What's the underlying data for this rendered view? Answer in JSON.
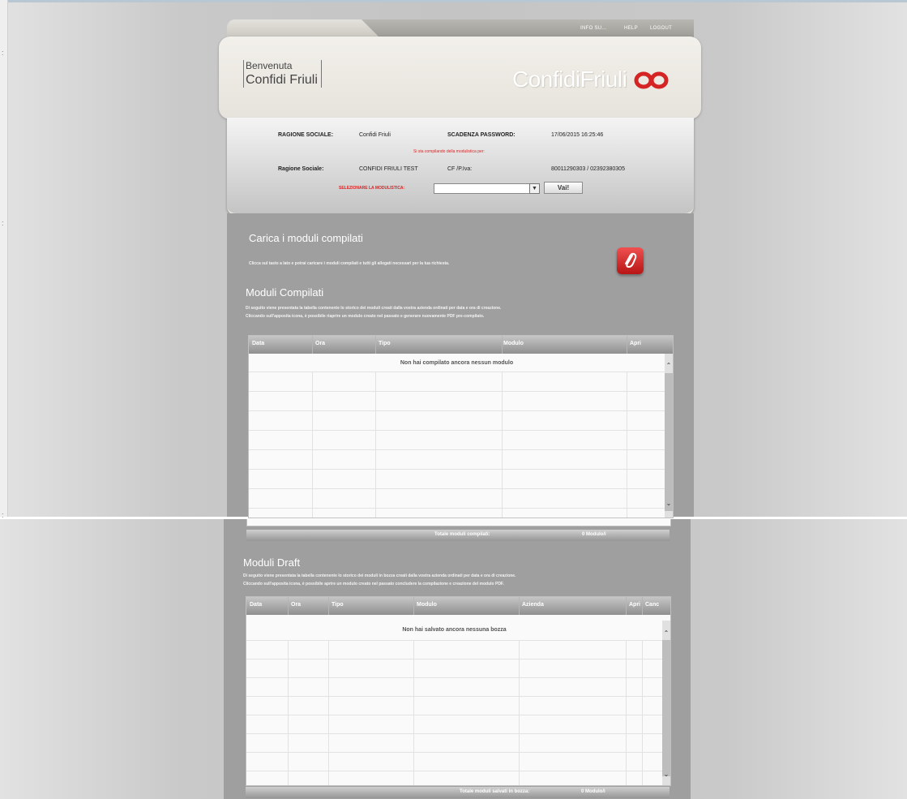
{
  "nav": {
    "info": "INFO SU...",
    "help": "HELP",
    "logout": "LOGOUT"
  },
  "welcome": {
    "line1": "Benvenuta",
    "line2": "Confidi Friuli"
  },
  "logo": {
    "text": "ConfidiFriuli"
  },
  "info": {
    "ragione_label": "RAGIONE SOCIALE:",
    "ragione_value": "Confidi Friuli",
    "scadenza_label": "SCADENZA PASSWORD:",
    "scadenza_value": "17/06/2015 16:25:46",
    "notice": "Si sta compilando della modulistica per:",
    "ragione2_label": "Ragione Sociale:",
    "ragione2_value": "CONFIDI FRIULI TEST",
    "cf_label": "CF /P.Iva:",
    "cf_value": "80011290303 / 02392380305",
    "select_label": "SELEZIONARE LA MODULISTICA:",
    "select_value": "",
    "go_button": "Vai!"
  },
  "upload": {
    "title": "Carica i moduli compilati",
    "text": "Clicca sul tasto a lato e potrai caricare i moduli compilati e tutti gli allegati necessari per la tua richiesta."
  },
  "compilati": {
    "title": "Moduli Compilati",
    "text1": "Di seguito viene presentata la tabella contenente lo storico dei moduli creati dalla vostra azienda ordinati per data e ora di creazione.",
    "text2": "Cliccando sull'apposita icona, è possibile riaprire un modulo creato nel passato e generare nuovamente PDF pre-compilato.",
    "columns": [
      "Data",
      "Ora",
      "Tipo",
      "Modulo",
      "Apri"
    ],
    "empty": "Non hai compilato ancora nessun modulo",
    "footer_label": "Totale moduli compilati:",
    "footer_value": "0  Modulo/i"
  },
  "draft": {
    "title": "Moduli Draft",
    "text1": "Di seguito viene presentata la tabella contenente lo storico dei moduli in bozza creati dalla vostra azienda ordinati per data e ora di creazione.",
    "text2": "Cliccando sull'apposita icona, è possibile aprire un modulo creato nel passato concludere la compilazione e creazione del modulo PDF.",
    "columns": [
      "Data",
      "Ora",
      "Tipo",
      "Modulo",
      "Azienda",
      "Apri",
      "Canc"
    ],
    "empty": "Non hai salvato ancora nessuna bozza",
    "footer_label": "Totale moduli salvati in bozza:",
    "footer_value": "0  Modulo/i"
  },
  "colors": {
    "accent_red": "#d22222",
    "panel_grey": "#9f9f9f"
  },
  "icons": [
    "chevron-down-icon",
    "paperclip-icon",
    "scroll-up-icon",
    "scroll-down-icon",
    "logo-infinity-icon"
  ]
}
